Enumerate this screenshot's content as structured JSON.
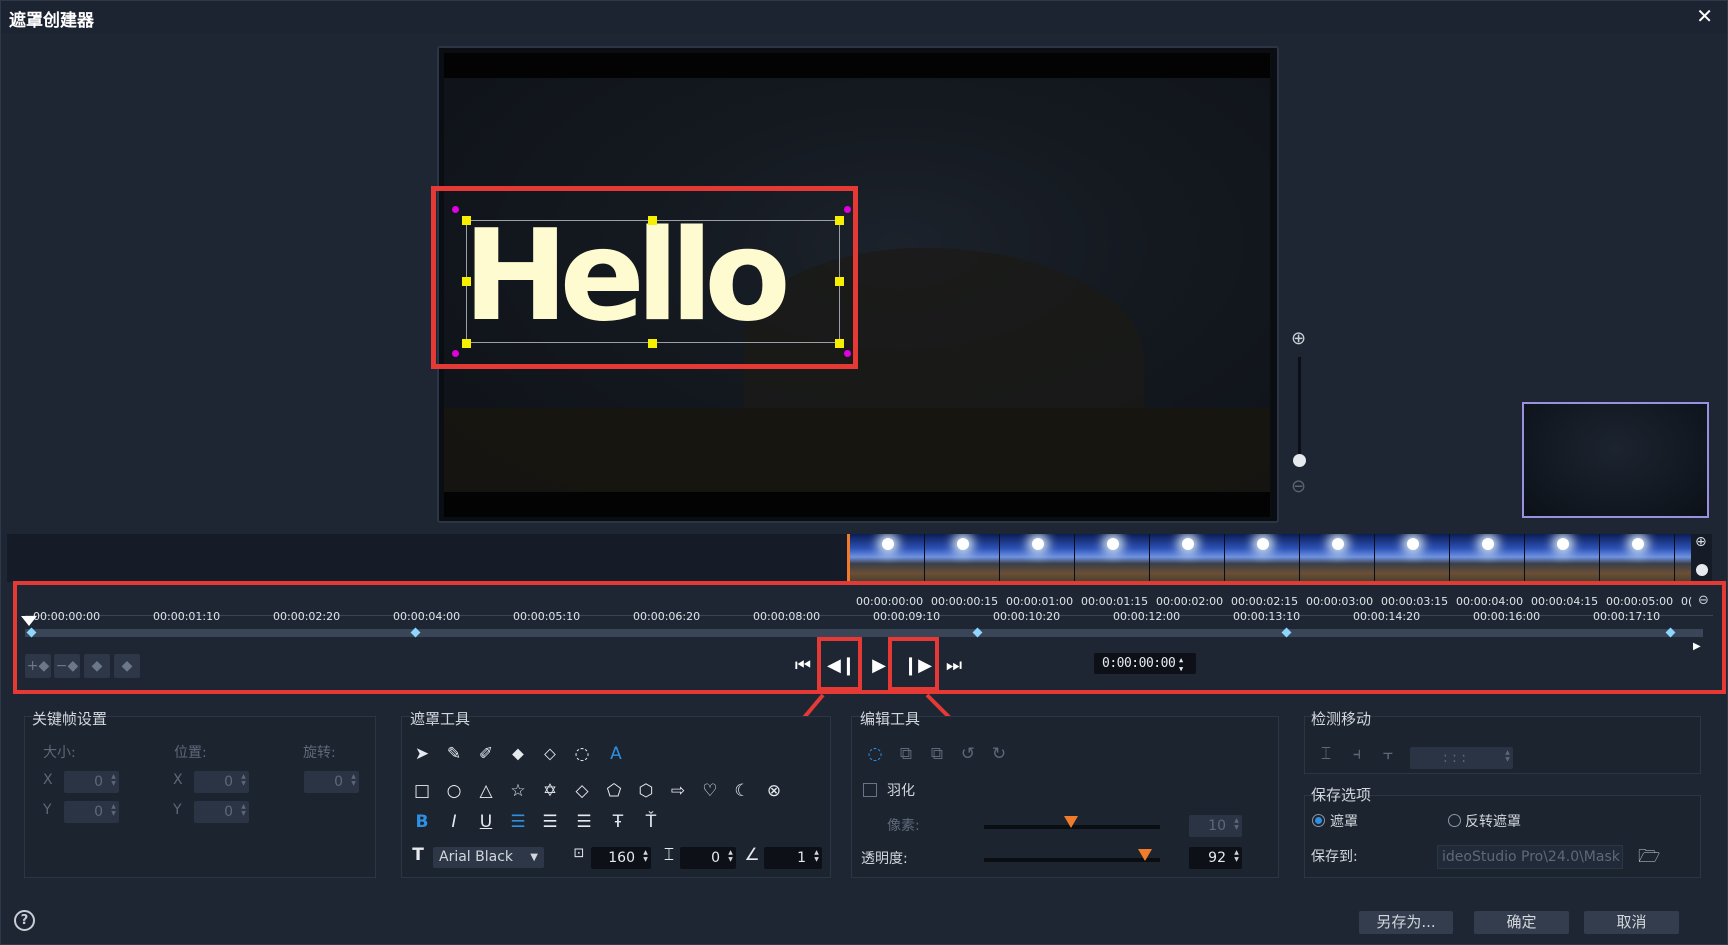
{
  "window": {
    "title": "遮罩创建器",
    "close_glyph": "✕"
  },
  "preview": {
    "text_object": "Hello",
    "zoom_in_icon": "zoom-in-icon",
    "zoom_out_icon": "zoom-out-icon"
  },
  "timeline": {
    "ruler_bottom": [
      "00:00:00:00",
      "00:00:01:10",
      "00:00:02:20",
      "00:00:04:00",
      "00:00:05:10",
      "00:00:06:20",
      "00:00:08:00",
      "00:00:09:10",
      "00:00:10:20",
      "00:00:12:00",
      "00:00:13:10",
      "00:00:14:20",
      "00:00:16:00",
      "00:00:17:10"
    ],
    "ruler_top": [
      "00:00:00:00",
      "00:00:00:15",
      "00:00:01:00",
      "00:00:01:15",
      "00:00:02:00",
      "00:00:02:15",
      "00:00:03:00",
      "00:00:03:15",
      "00:00:04:00",
      "00:00:04:15",
      "00:00:05:00",
      "0("
    ],
    "timecode": "0:00:00:00",
    "transport": {
      "first": "⏮",
      "prev": "◀❙",
      "play": "▶",
      "next": "❙▶",
      "last": "⏭"
    }
  },
  "keyframe_settings": {
    "title": "关键帧设置",
    "size_label": "大小:",
    "position_label": "位置:",
    "rotation_label": "旋转:",
    "x": "X",
    "y": "Y",
    "size_x": "0",
    "size_y": "0",
    "pos_x": "0",
    "pos_y": "0",
    "rotation": "0"
  },
  "mask_tools": {
    "title": "遮罩工具",
    "font": "Arial Black",
    "font_size": "160",
    "line_spacing": "0",
    "angle": "1",
    "bold": "B",
    "italic": "I",
    "underline": "U"
  },
  "edit_tools": {
    "title": "编辑工具",
    "feather_label": "羽化",
    "pixels_label": "像素:",
    "pixels_value": "10",
    "opacity_label": "透明度:",
    "opacity_value": "92"
  },
  "motion_detect": {
    "title": "检测移动",
    "time_value": ":  :  :"
  },
  "save_options": {
    "title": "保存选项",
    "mask_option": "遮罩",
    "invert_option": "反转遮罩",
    "save_to_label": "保存到:",
    "save_path": "ideoStudio Pro\\24.0\\Mask"
  },
  "buttons": {
    "save_as": "另存为...",
    "ok": "确定",
    "cancel": "取消",
    "help": "?"
  },
  "colors": {
    "accent_red": "#e53935",
    "accent_orange": "#f07b2a",
    "accent_blue": "#2f8fe0"
  }
}
